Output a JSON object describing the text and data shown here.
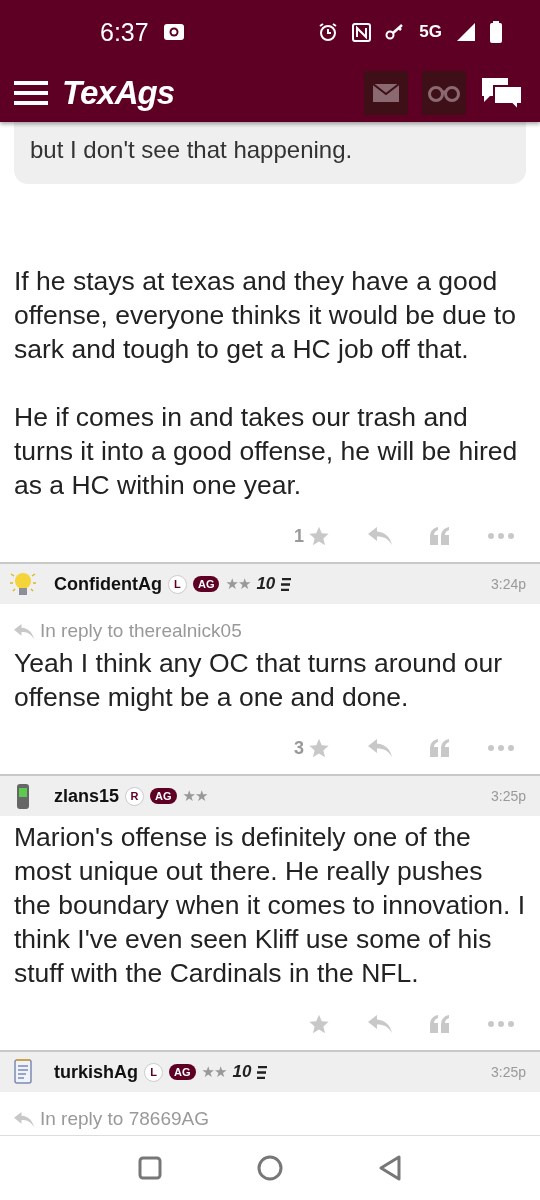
{
  "status_bar": {
    "time": "6:37",
    "network": "5G"
  },
  "app_bar": {
    "logo": "TexAgs"
  },
  "posts": [
    {
      "quote": "but I don't see that happening.",
      "paragraphs": [
        "If he stays at texas and they have a good offense, everyone thinks it would be due to sark and tough to get a HC job off that.",
        "He if comes in and takes our trash and turns it into a good offense, he will be hired as a HC within one year."
      ],
      "likes": "1"
    },
    {
      "author": "ConfidentAg",
      "avatar": {
        "kind": "bulb"
      },
      "badges": [
        {
          "label": "L",
          "kind": "circle"
        },
        {
          "label": "AG",
          "kind": "pill"
        }
      ],
      "star_mark": "★★",
      "rank": "10",
      "time": "3:24p",
      "reply_to": "In reply to therealnick05",
      "paragraphs": [
        "Yeah I think any OC that turns around our offense might be a one and done."
      ],
      "likes": "3"
    },
    {
      "author": "zlans15",
      "avatar": {
        "kind": "phone"
      },
      "badges": [
        {
          "label": "R",
          "kind": "circle"
        },
        {
          "label": "AG",
          "kind": "pill"
        }
      ],
      "star_mark": "★★",
      "time": "3:25p",
      "paragraphs": [
        "Marion's offense is definitely one of the most unique out there. He really pushes the boundary when it comes to innovation. I think I've even seen Kliff use some of his stuff with the Cardinals in the NFL."
      ]
    },
    {
      "author": "turkishAg",
      "avatar": {
        "kind": "notepad"
      },
      "badges": [
        {
          "label": "L",
          "kind": "circle"
        },
        {
          "label": "AG",
          "kind": "pill"
        }
      ],
      "star_mark": "★★",
      "rank": "10",
      "time": "3:25p",
      "reply_to": "In reply to 78669AG"
    }
  ]
}
